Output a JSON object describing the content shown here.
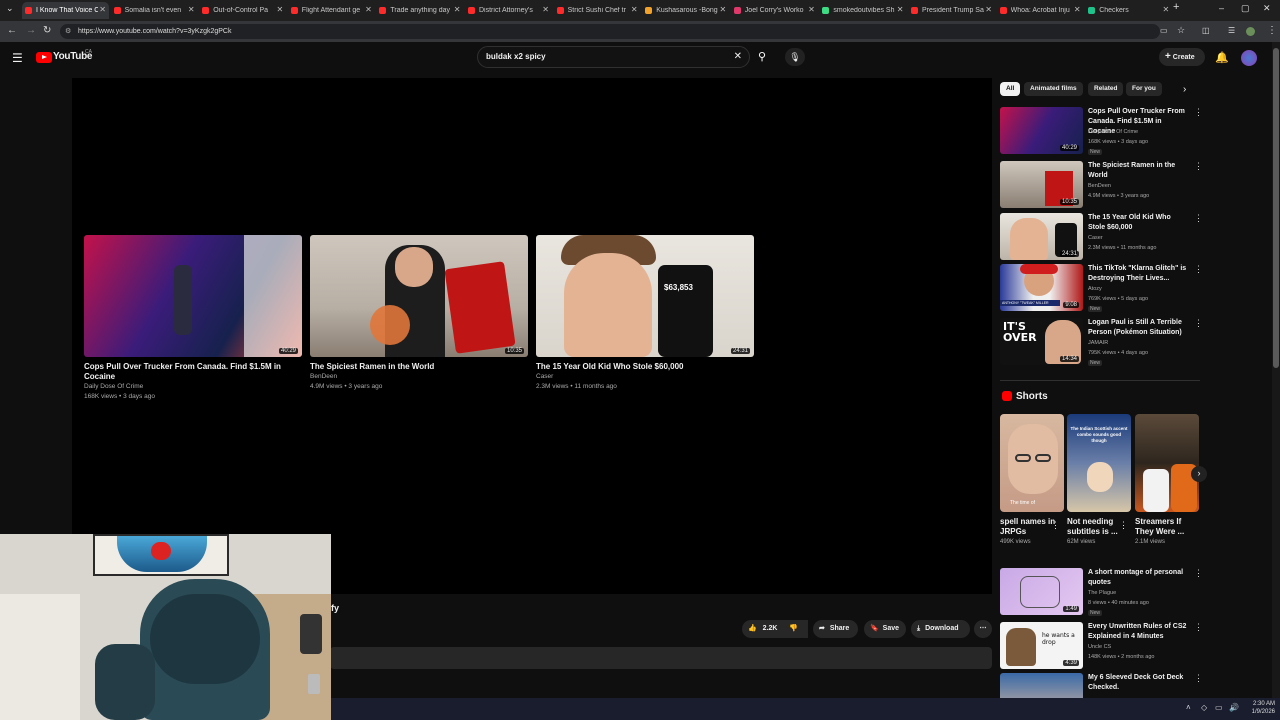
{
  "browser": {
    "tabs": [
      {
        "title": "I Know That Voice C",
        "color": "#ff2a2a",
        "active": true
      },
      {
        "title": "Somalia isn't even ",
        "color": "#ff2a2a"
      },
      {
        "title": "Out-of-Control Pa",
        "color": "#ff2a2a"
      },
      {
        "title": "Flight Attendant ge",
        "color": "#ff2a2a"
      },
      {
        "title": "Trade anything day",
        "color": "#ff2a2a"
      },
      {
        "title": "District Attorney's",
        "color": "#ff2a2a"
      },
      {
        "title": "Strict Sushi Chef tr",
        "color": "#ff2a2a"
      },
      {
        "title": "Kushasarous -Bong",
        "color": "#f2a22a"
      },
      {
        "title": "Joel Corry's Worko",
        "color": "#e0386b"
      },
      {
        "title": "smokedoutvibes Sh",
        "color": "#3ddc84"
      },
      {
        "title": "President Trump Sa",
        "color": "#ff2a2a"
      },
      {
        "title": "Whoa: Acrobat Inju",
        "color": "#ff2a2a"
      },
      {
        "title": "Checkers",
        "color": "#1ec28b"
      }
    ],
    "url": "https://www.youtube.com/watch?v=3yKzgk2gPCk"
  },
  "youtube": {
    "logo": "YouTube",
    "region": "CA",
    "search_query": "buldak x2 spicy",
    "create_label": "Create"
  },
  "endcards": [
    {
      "title": "Cops Pull Over Trucker From Canada. Find $1.5M in Cocaine",
      "channel": "Daily Dose Of Crime",
      "meta": "168K views • 3 days ago",
      "duration": "40:29"
    },
    {
      "title": "The Spiciest Ramen in the World",
      "channel": "BenDeen",
      "meta": "4.9M views • 3 years ago",
      "duration": "10:35"
    },
    {
      "title": "The 15 Year Old Kid Who Stole $60,000",
      "channel": "Caser",
      "meta": "2.3M views • 11 months ago",
      "duration": "24:31",
      "phone_amount": "$63,853"
    }
  ],
  "video_title_fragment": "fy",
  "actions": {
    "likes": "2.2K",
    "share": "Share",
    "save": "Save",
    "download": "Download"
  },
  "chips": [
    "All",
    "Animated films",
    "Related",
    "For you"
  ],
  "recommended": [
    {
      "title": "Cops Pull Over Trucker From Canada. Find $1.5M in Cocaine",
      "channel": "Daily Dose Of Crime",
      "views": "168K views • 3 days ago",
      "badge": "New",
      "duration": "40:29"
    },
    {
      "title": "The Spiciest Ramen in the World",
      "channel": "BenDeen",
      "views": "4.9M views • 3 years ago",
      "badge": "",
      "duration": "10:35"
    },
    {
      "title": "The 15 Year Old Kid Who Stole $60,000",
      "channel": "Caser",
      "views": "2.3M views • 11 months ago",
      "badge": "",
      "duration": "24:31"
    },
    {
      "title": "This TikTok \"Klarna Glitch\" is Destroying Their Lives...",
      "channel": "Atozy",
      "views": "769K views • 5 days ago",
      "badge": "New",
      "duration": "9:08"
    },
    {
      "title": "Logan Paul is Still A Terrible Person (Pokémon Situation)",
      "channel": "JAMAIR",
      "views": "795K views • 4 days ago",
      "badge": "New",
      "duration": "14:34"
    }
  ],
  "shorts_header": "Shorts",
  "shorts": [
    {
      "title": "spell names in JRPGs",
      "views": "499K views",
      "overlay": "The time of"
    },
    {
      "title": "Not needing subtitles is ...",
      "views": "62M views",
      "overlay": "The Indian Scottish accent combo sounds good though"
    },
    {
      "title": "Streamers If They Were ...",
      "views": "2.1M views",
      "overlay": ""
    }
  ],
  "recommended2": [
    {
      "title": "A short montage of personal quotes",
      "channel": "The Plague",
      "views": "8 views • 40 minutes ago",
      "badge": "New",
      "duration": "1:49"
    },
    {
      "title": "Every Unwritten Rules of CS2 Explained in 4 Minutes",
      "channel": "Uncle CS",
      "views": "148K views • 2 months ago",
      "badge": "",
      "duration": "4:39",
      "overlay": "he wants a drop"
    },
    {
      "title": "My 6 Sleeved Deck Got Deck Checked.",
      "channel": "",
      "views": "",
      "badge": "",
      "duration": ""
    }
  ],
  "thumb_text": {
    "itsover": "IT'S OVER",
    "anthony": "ANTHONY \"TWEAK\" MILLER"
  },
  "taskbar": {
    "time": "2:30 AM",
    "date": "1/9/2026"
  }
}
